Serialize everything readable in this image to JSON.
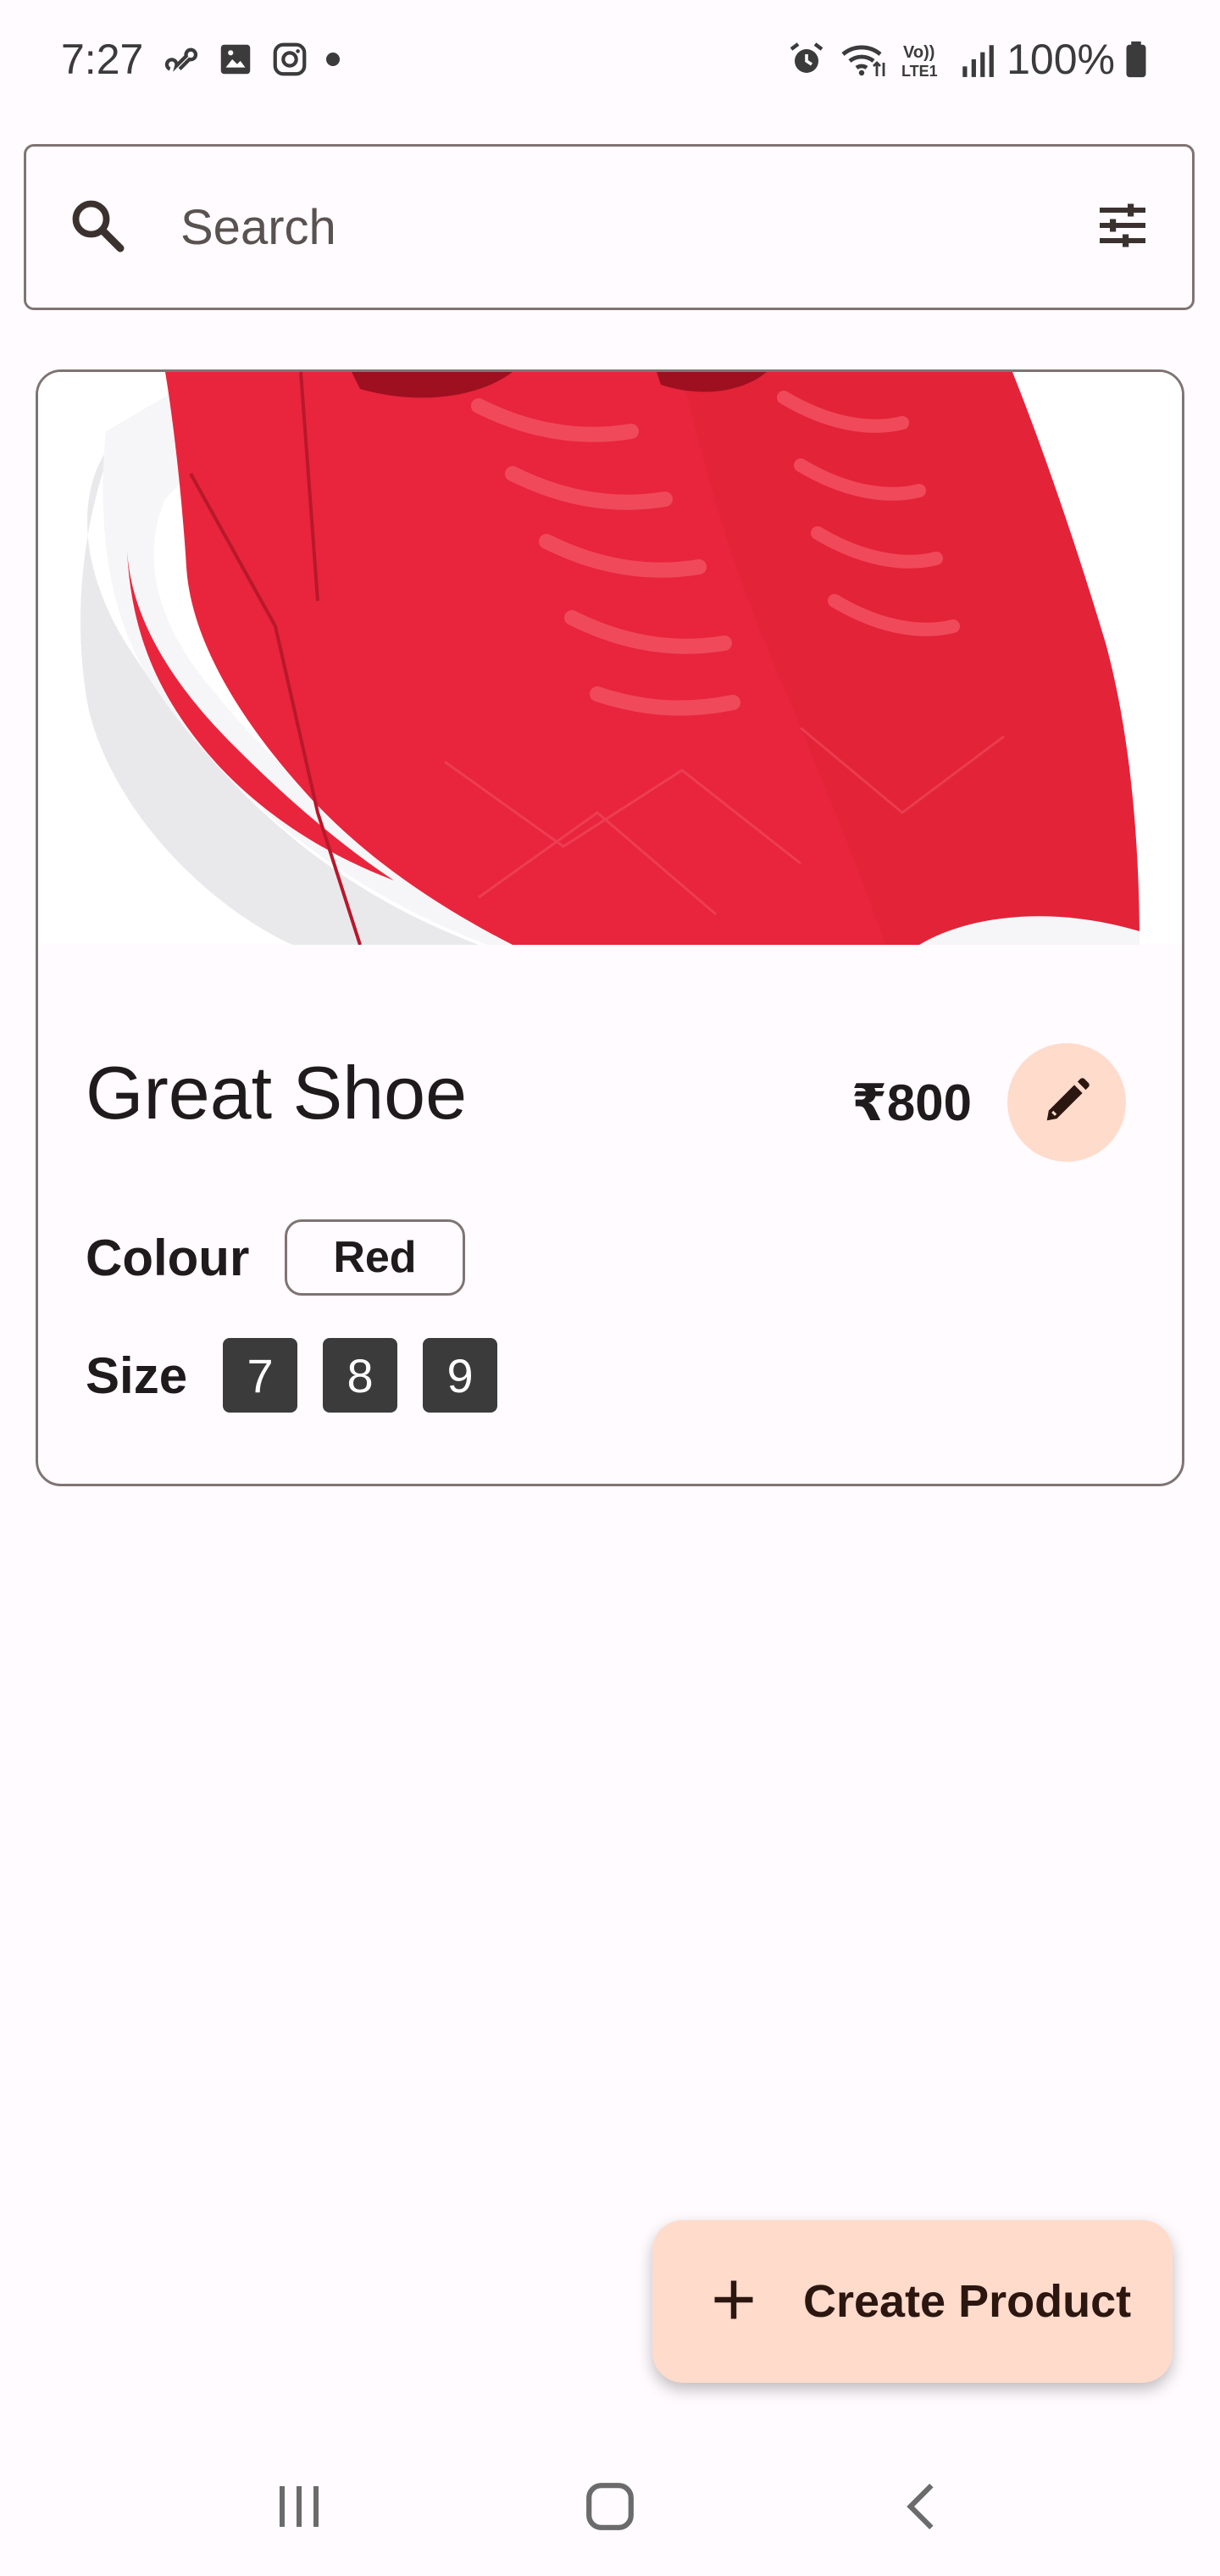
{
  "status_bar": {
    "time": "7:27",
    "battery_percent": "100%",
    "left_icons": [
      "link-icon",
      "gallery-icon",
      "instagram-icon",
      "dot-icon"
    ],
    "right_icons": [
      "alarm-icon",
      "wifi-icon",
      "volte-lte-icon",
      "signal-icon",
      "battery-icon"
    ]
  },
  "search": {
    "placeholder": "Search",
    "value": ""
  },
  "product": {
    "image_alt": "red-sneaker-image",
    "title": "Great Shoe",
    "price": "₹800",
    "colour_label": "Colour",
    "colour_value": "Red",
    "size_label": "Size",
    "sizes": [
      "7",
      "8",
      "9"
    ]
  },
  "fab": {
    "label": "Create Product"
  },
  "colors": {
    "accent_container": "#ffdbcc",
    "outline": "#7f7473",
    "background": "#fffbfe",
    "chip_dark": "#3b3b3b",
    "shoe_red": "#e8253d"
  }
}
